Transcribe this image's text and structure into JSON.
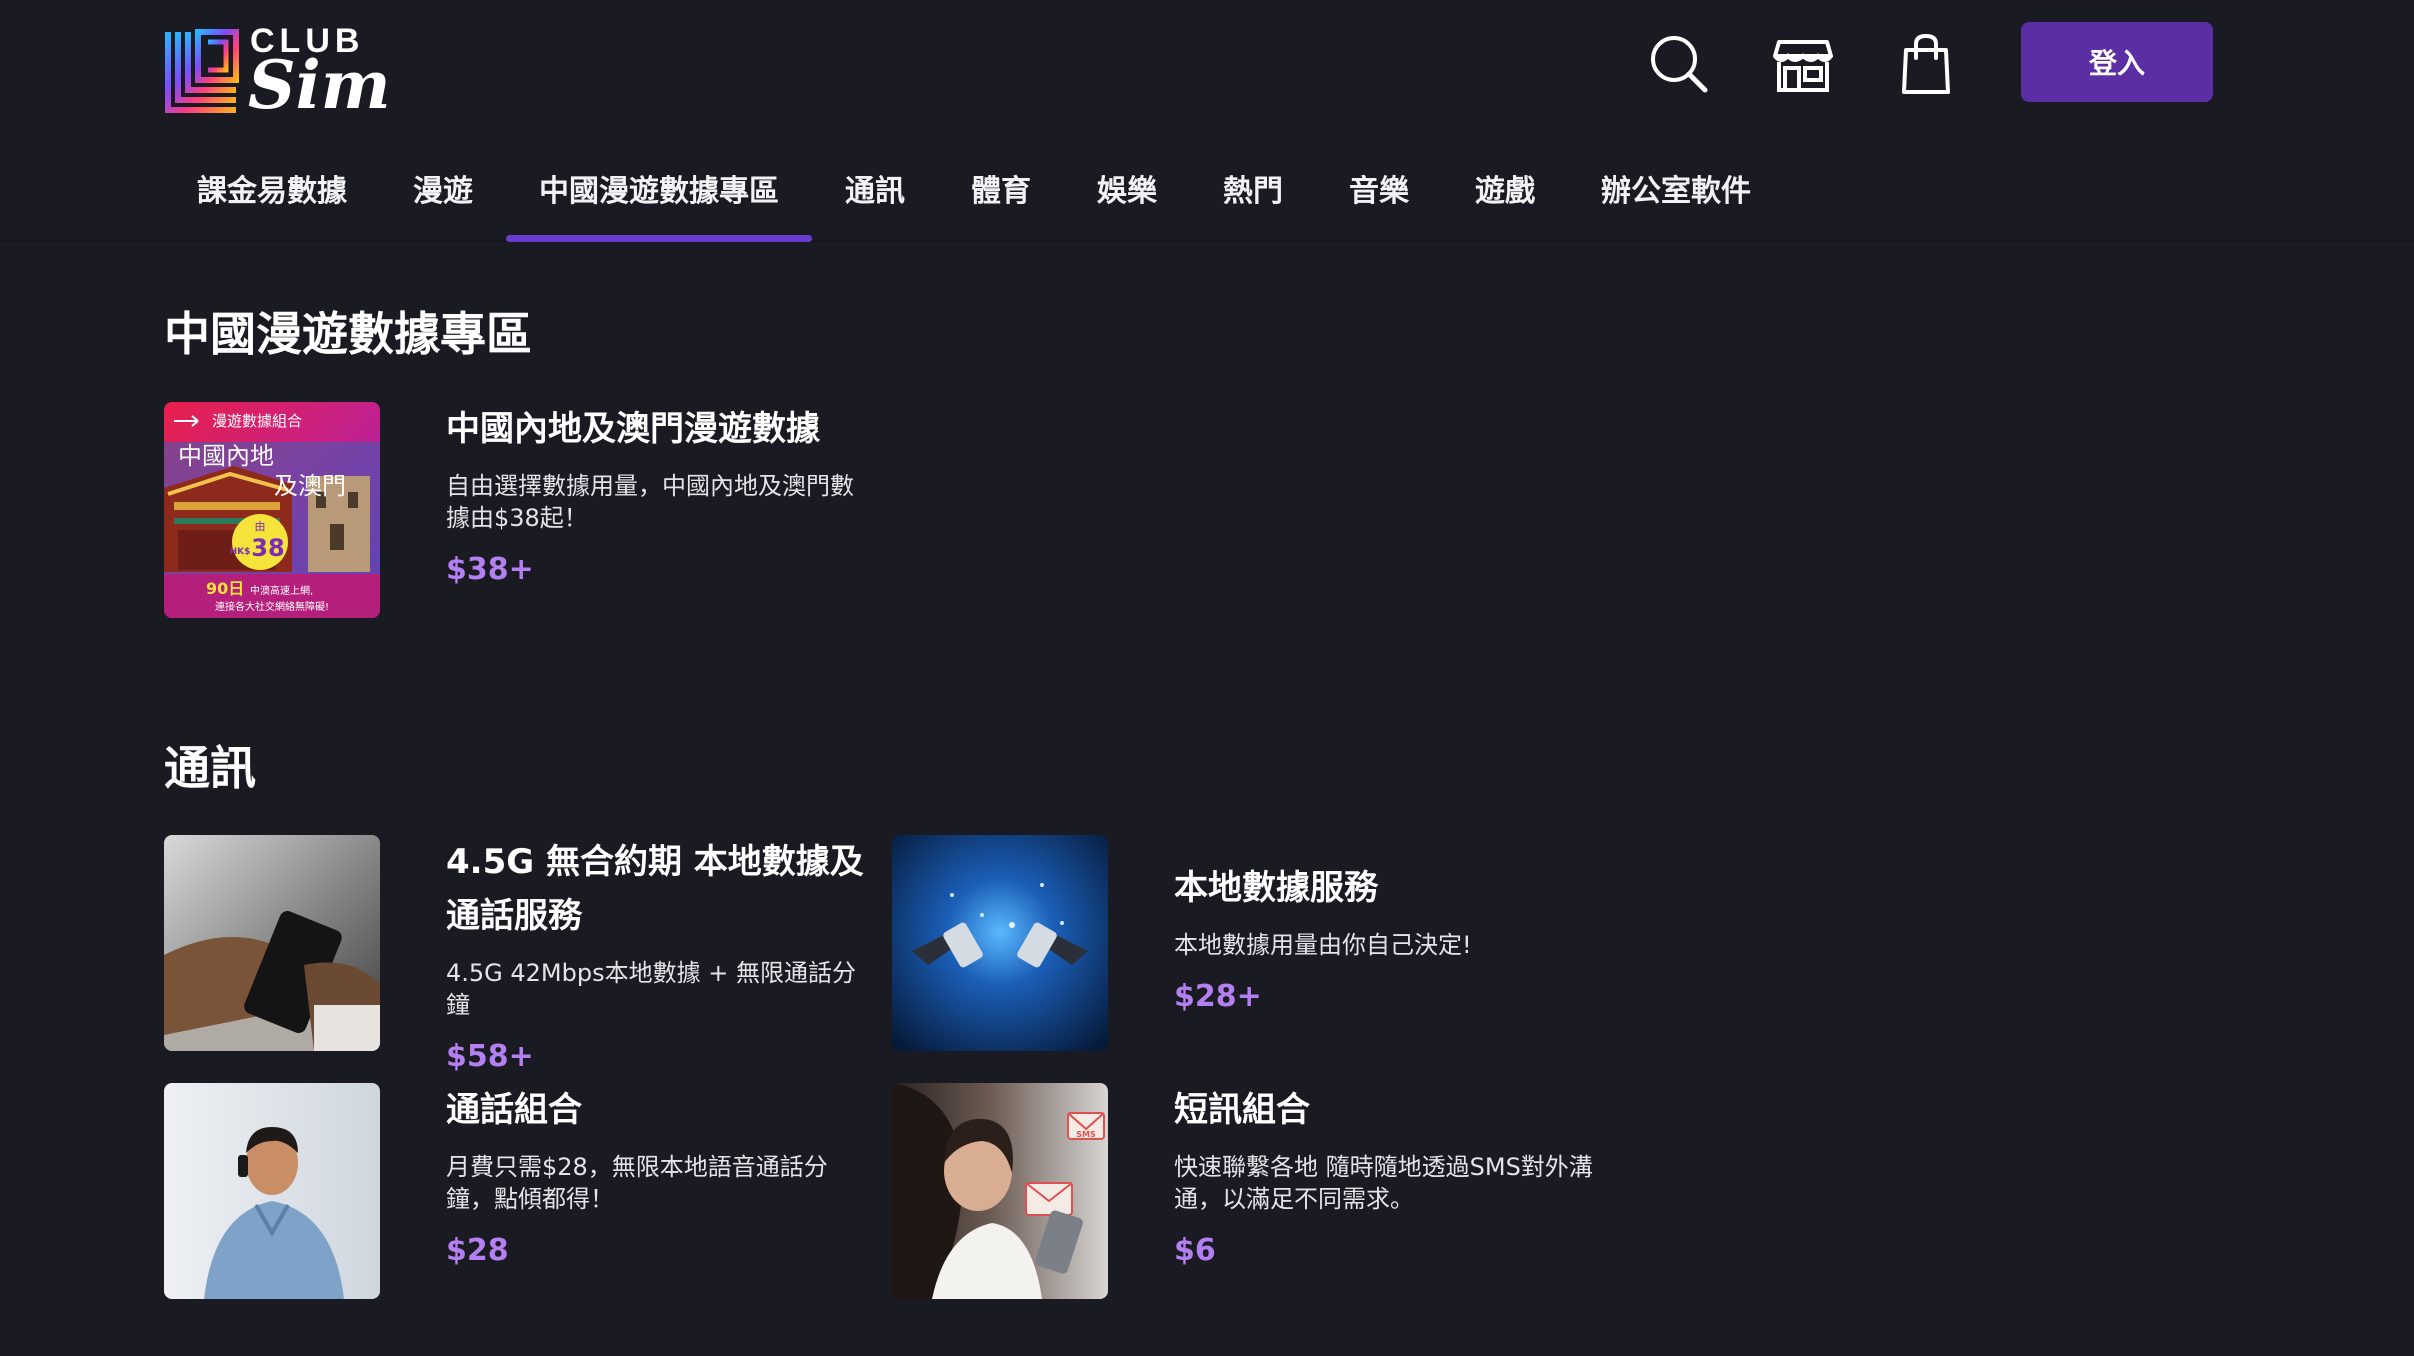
{
  "brand": {
    "club": "CLUB",
    "sim": "Sim"
  },
  "header": {
    "login_label": "登入",
    "accent_color": "#5b2ea3",
    "price_color": "#b47ff0"
  },
  "icons": [
    "search-icon",
    "store-icon",
    "shopping-bag-icon"
  ],
  "nav": {
    "tabs": [
      {
        "label": "課金易數據"
      },
      {
        "label": "漫遊"
      },
      {
        "label": "中國漫遊數據專區",
        "active": true
      },
      {
        "label": "通訊"
      },
      {
        "label": "體育"
      },
      {
        "label": "娛樂"
      },
      {
        "label": "熱門"
      },
      {
        "label": "音樂"
      },
      {
        "label": "遊戲"
      },
      {
        "label": "辦公室軟件"
      }
    ]
  },
  "sections": [
    {
      "title": "中國漫遊數據專區",
      "cards": [
        {
          "title": "中國內地及澳門漫遊數據",
          "desc": "自由選擇數據用量，中國內地及澳門數據由$38起！",
          "price": "$38+",
          "thumb": {
            "tag": "漫遊數據組合",
            "line1": "中國內地",
            "line2": "及澳門",
            "badge_top": "由",
            "badge_unit": "HK$",
            "badge_value": "38",
            "footer_days": "90日",
            "footer_text1": "中澳高速上網,",
            "footer_text2": "連接各大社交網絡無障礙!"
          }
        }
      ]
    },
    {
      "title": "通訊",
      "cards": [
        {
          "title": "4.5G 無合約期 本地數據及通話服務",
          "desc": "4.5G 42Mbps本地數據 + 無限通話分鐘",
          "price": "$58+"
        },
        {
          "title": "本地數據服務",
          "desc": "本地數據用量由你自己決定!",
          "price": "$28+"
        },
        {
          "title": "通話組合",
          "desc": "月費只需$28，無限本地語音通話分鐘，點傾都得！",
          "price": "$28"
        },
        {
          "title": "短訊組合",
          "desc": "快速聯繫各地 隨時隨地透過SMS對外溝通，以滿足不同需求。",
          "price": "$6",
          "thumb": {
            "sms_label": "SMS"
          }
        }
      ]
    }
  ]
}
